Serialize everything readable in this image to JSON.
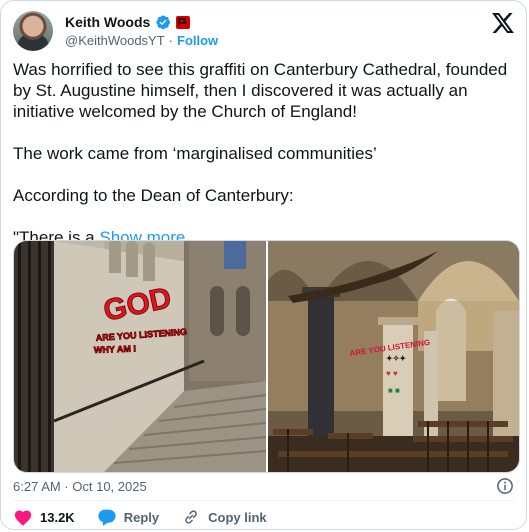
{
  "author": {
    "name": "Keith Woods",
    "handle": "@KeithWoodsYT",
    "separator": "·",
    "follow_label": "Follow"
  },
  "tweet": {
    "text": "Was horrified to see this graffiti on Canterbury Cathedral, founded by St. Augustine himself, then I discovered it was actually an initiative welcomed by the Church of England!\n\nThe work came from ‘marginalised communities’\n\nAccording to the Dean of Canterbury:\n\n\"There is a ",
    "show_more": "Show more"
  },
  "meta": {
    "timestamp": "6:27 AM · Oct 10, 2025"
  },
  "actions": {
    "likes": "13.2K",
    "reply_label": "Reply",
    "copy_link_label": "Copy link"
  },
  "photos": [
    {
      "graffiti_text": "GOD"
    },
    {
      "graffiti_text": "ARE YOU LISTENING"
    }
  ],
  "colors": {
    "accent": "#1d9bf0",
    "like": "#f91880",
    "text": "#0f1419",
    "muted": "#536471"
  },
  "icons": [
    "verified-badge-icon",
    "flag-icon",
    "x-logo-icon",
    "info-icon",
    "heart-icon",
    "reply-icon",
    "link-icon"
  ]
}
